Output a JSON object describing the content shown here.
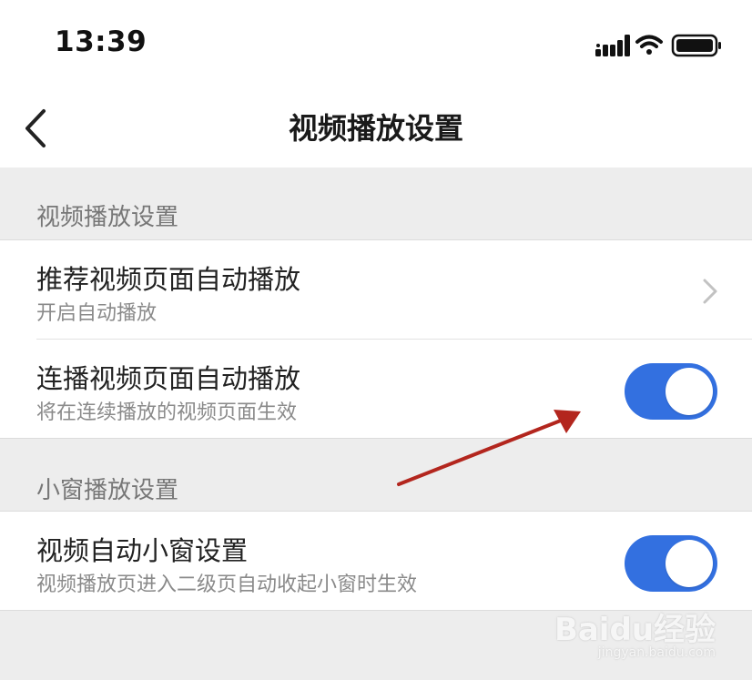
{
  "status_bar": {
    "time": "13:39",
    "icons": [
      "cellular-signal-icon",
      "wifi-icon",
      "battery-icon"
    ]
  },
  "nav": {
    "title": "视频播放设置",
    "back_icon": "chevron-left-icon"
  },
  "sections": [
    {
      "header": "视频播放设置",
      "rows": [
        {
          "title": "推荐视频页面自动播放",
          "subtitle": "开启自动播放",
          "control": "chevron-right-icon"
        },
        {
          "title": "连播视频页面自动播放",
          "subtitle": "将在连续播放的视频页面生效",
          "control": "toggle",
          "on": true
        }
      ]
    },
    {
      "header": "小窗播放设置",
      "rows": [
        {
          "title": "视频自动小窗设置",
          "subtitle": "视频播放页进入二级页自动收起小窗时生效",
          "control": "toggle",
          "on": true
        }
      ]
    }
  ],
  "colors": {
    "toggle_on": "#3370e0",
    "annotation_arrow": "#b3261e",
    "background": "#ededed"
  },
  "watermark": {
    "logo": "Baidu经验",
    "url": "jingyan.baidu.com"
  }
}
